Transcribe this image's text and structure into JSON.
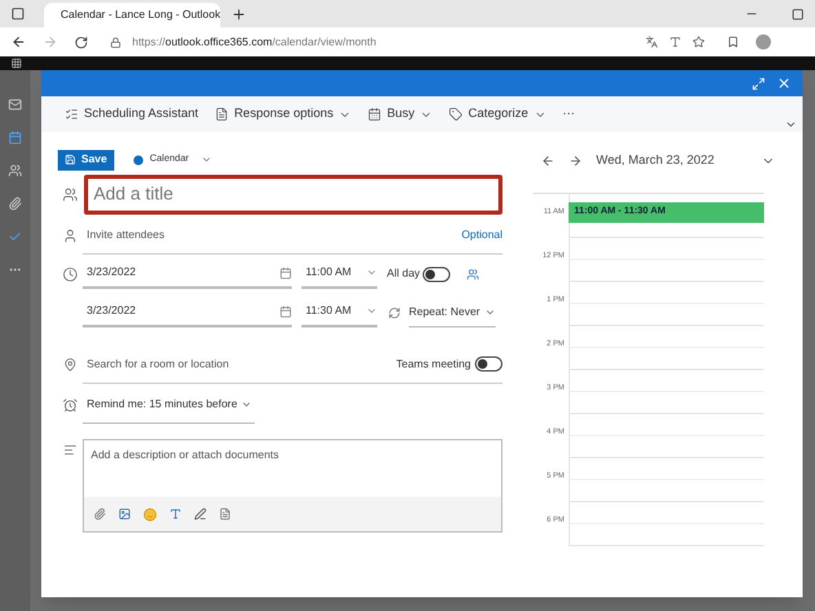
{
  "browser": {
    "tab_title": "Calendar - Lance Long - Outlook",
    "url_scheme": "https://",
    "url_host": "outlook.office365.com",
    "url_path": "/calendar/view/month"
  },
  "toolbar": [
    {
      "kind": "scheduling",
      "label": "Scheduling Assistant",
      "caret": false
    },
    {
      "kind": "response",
      "label": "Response options",
      "caret": true
    },
    {
      "kind": "busy",
      "label": "Busy",
      "caret": true
    },
    {
      "kind": "category",
      "label": "Categorize",
      "caret": true
    },
    {
      "kind": "more",
      "label": "···",
      "caret": false
    }
  ],
  "form": {
    "save": "Save",
    "calendar": "Calendar",
    "title_placeholder": "Add a title",
    "title_highlighted": true,
    "attendees_placeholder": "Invite attendees",
    "optional": "Optional",
    "start_date": "3/23/2022",
    "start_time": "11:00 AM",
    "all_day": {
      "label": "All day",
      "on": false
    },
    "end_date": "3/23/2022",
    "end_time": "11:30 AM",
    "repeat": "Repeat: Never",
    "location_placeholder": "Search for a room or location",
    "teams": {
      "label": "Teams meeting",
      "on": false
    },
    "reminder": "Remind me: 15 minutes before",
    "description_placeholder": "Add a description or attach documents"
  },
  "day_view": {
    "date": "Wed, March 23, 2022",
    "hours": [
      "11 AM",
      "12 PM",
      "1 PM",
      "2 PM",
      "3 PM",
      "4 PM",
      "5 PM",
      "6 PM"
    ],
    "event": "11:00 AM - 11:30 AM"
  }
}
